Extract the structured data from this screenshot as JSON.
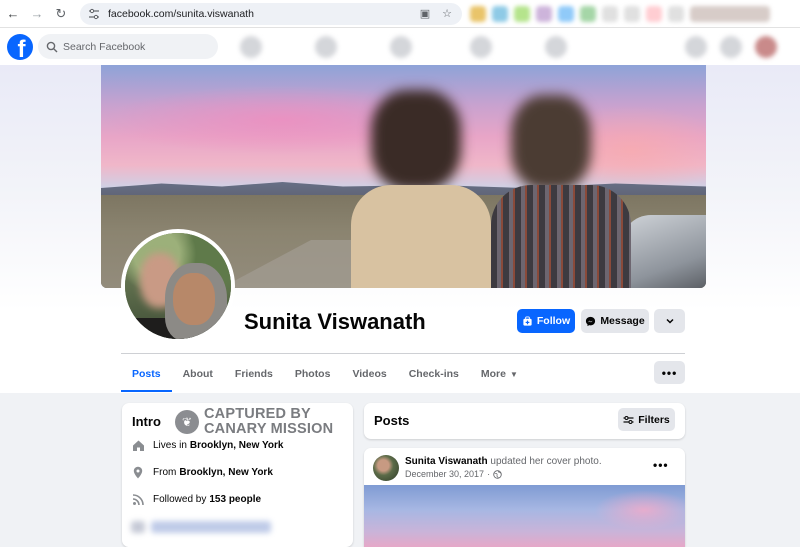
{
  "browser": {
    "url": "facebook.com/sunita.viswanath"
  },
  "header": {
    "logo_letter": "f",
    "search_placeholder": "Search Facebook"
  },
  "profile": {
    "name": "Sunita Viswanath",
    "follow_label": "Follow",
    "message_label": "Message"
  },
  "tabs": [
    {
      "label": "Posts",
      "active": true
    },
    {
      "label": "About"
    },
    {
      "label": "Friends"
    },
    {
      "label": "Photos"
    },
    {
      "label": "Videos"
    },
    {
      "label": "Check-ins"
    },
    {
      "label": "More"
    }
  ],
  "intro": {
    "title": "Intro",
    "watermark_line1": "CAPTURED BY",
    "watermark_line2": "CANARY MISSION",
    "lives_prefix": "Lives in",
    "lives_place": "Brooklyn, New York",
    "from_prefix": "From",
    "from_place": "Brooklyn, New York",
    "followed_prefix": "Followed by",
    "followed_count": "153 people"
  },
  "posts": {
    "title": "Posts",
    "filters_label": "Filters",
    "post_author": "Sunita Viswanath",
    "post_action": "updated her cover photo.",
    "post_date": "December 30, 2017"
  },
  "colors": {
    "brand": "#0866ff",
    "button_gray": "#e4e6eb",
    "page_bg": "#f0f2f5"
  }
}
